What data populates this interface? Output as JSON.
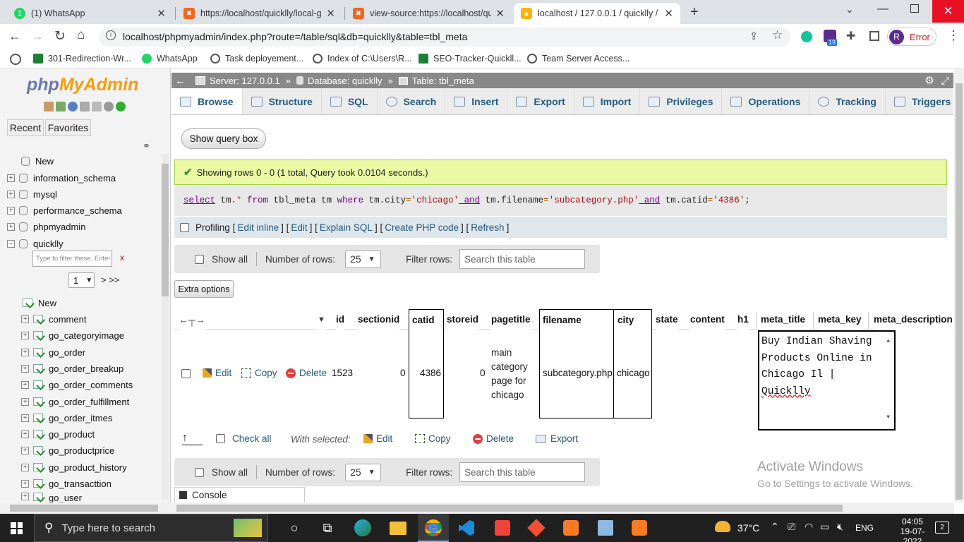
{
  "browser": {
    "tabs": [
      {
        "title": "(1) WhatsApp",
        "icon": "whatsapp-icon",
        "color": "#25d366"
      },
      {
        "title": "https://localhost/quicklly/local-g",
        "icon": "xampp-icon",
        "color": "#f26522"
      },
      {
        "title": "view-source:https://localhost/qui",
        "icon": "xampp-icon",
        "color": "#f26522"
      },
      {
        "title": "localhost / 127.0.0.1 / quicklly / t",
        "icon": "phpmyadmin-icon",
        "color": "#f89c0e"
      }
    ],
    "address": "localhost/phpmyadmin/index.php?route=/table/sql&db=quicklly&table=tbl_meta",
    "profile_initial": "R",
    "profile_status": "Error",
    "extension_badge": "19",
    "bookmarks": [
      "301-Redirection-Wr...",
      "WhatsApp",
      "Task deployement...",
      "Index of C:\\Users\\R...",
      "SEO-Tracker-Quickll...",
      "Team Server Access..."
    ]
  },
  "sidebar": {
    "logo_php": "php",
    "logo_myadmin": "MyAdmin",
    "recent": "Recent",
    "favorites": "Favorites",
    "new_label": "New",
    "databases": [
      "information_schema",
      "mysql",
      "performance_schema",
      "phpmyadmin",
      "quicklly"
    ],
    "filter_placeholder": "Type to filter these, Enter",
    "filter_clear": "x",
    "page_select": "1",
    "page_next": "> >>",
    "tables": [
      "New",
      "comment",
      "go_categoryimage",
      "go_order",
      "go_order_breakup",
      "go_order_comments",
      "go_order_fulfillment",
      "go_order_itmes",
      "go_product",
      "go_productprice",
      "go_product_history",
      "go_transacttion",
      "go_user"
    ]
  },
  "breadcrumb": {
    "server": "Server: 127.0.0.1",
    "database": "Database: quicklly",
    "table": "Table: tbl_meta"
  },
  "menu_tabs": [
    "Browse",
    "Structure",
    "SQL",
    "Search",
    "Insert",
    "Export",
    "Import",
    "Privileges",
    "Operations",
    "Tracking",
    "Triggers"
  ],
  "show_query_box": "Show query box",
  "success_message": "Showing rows 0 - 0 (1 total, Query took 0.0104 seconds.)",
  "sql_query": {
    "parts": [
      "select",
      " tm.",
      "*",
      " from",
      " tbl_meta tm ",
      "where",
      " tm.city",
      "=",
      "'chicago'",
      " and",
      " tm.filename",
      "=",
      "'subcategory.php'",
      " and",
      " tm.catid",
      "=",
      "'4386'",
      ";"
    ]
  },
  "profiling": {
    "label": "Profiling",
    "links": [
      "Edit inline",
      "Edit",
      "Explain SQL",
      "Create PHP code",
      "Refresh"
    ]
  },
  "nav": {
    "show_all": "Show all",
    "rows_label": "Number of rows:",
    "rows_value": "25",
    "filter_label": "Filter rows:",
    "filter_placeholder": "Search this table"
  },
  "extra_options": "Extra options",
  "grid": {
    "columns": [
      "id",
      "sectionid",
      "catid",
      "storeid",
      "pagetitle",
      "filename",
      "city",
      "state",
      "content",
      "h1",
      "meta_title",
      "meta_key",
      "meta_description"
    ],
    "row": {
      "edit": "Edit",
      "copy": "Copy",
      "delete": "Delete",
      "id": "1523",
      "sectionid": "0",
      "catid": "4386",
      "storeid": "0",
      "pagetitle_lines": [
        "main",
        "category",
        "page for",
        "chicago"
      ],
      "filename": "subcategory.php",
      "city": "chicago"
    },
    "editor_lines": [
      "Buy Indian Shaving",
      "Products Online in",
      "Chicago Il |",
      "Quicklly"
    ]
  },
  "bulk": {
    "check_all": "Check all",
    "with_selected": "With selected:",
    "actions": [
      "Edit",
      "Copy",
      "Delete",
      "Export"
    ]
  },
  "console": "Console",
  "watermark": {
    "title": "Activate Windows",
    "sub": "Go to Settings to activate Windows."
  },
  "taskbar": {
    "search_placeholder": "Type here to search",
    "temperature": "37°C",
    "language": "ENG",
    "time": "04:05",
    "date": "19-07-2022",
    "notifications": "2"
  }
}
